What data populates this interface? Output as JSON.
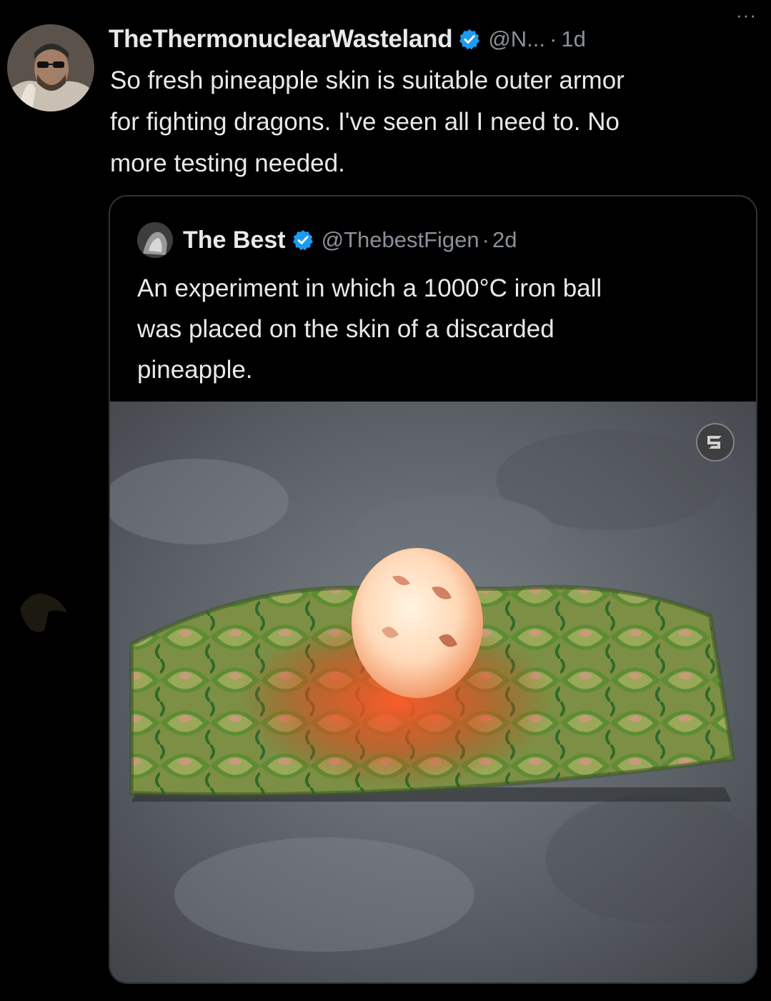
{
  "tweet": {
    "display_name": "TheThermonuclearWasteland",
    "handle": "@N...",
    "separator": "·",
    "time": "1d",
    "more_label": "···",
    "text_lines": [
      "So fresh pineapple skin is suitable outer armor",
      "for fighting dragons. I've seen all I need to. No",
      "more testing needed."
    ]
  },
  "quote": {
    "display_name": "The Best",
    "handle": "@ThebestFigen",
    "separator": "·",
    "time": "2d",
    "text_lines": [
      "An experiment in which a 1000°C iron ball",
      "was placed on the skin of a discarded",
      "pineapple."
    ]
  },
  "icons": {
    "avatar": "user-avatar",
    "verified": "verified-badge-icon",
    "media_badge": "media-watermark-icon"
  },
  "colors": {
    "background": "#000000",
    "text_primary": "#e7e9ea",
    "text_secondary": "#8b9198",
    "verified": "#1d9bf0",
    "border": "#2f3336"
  }
}
